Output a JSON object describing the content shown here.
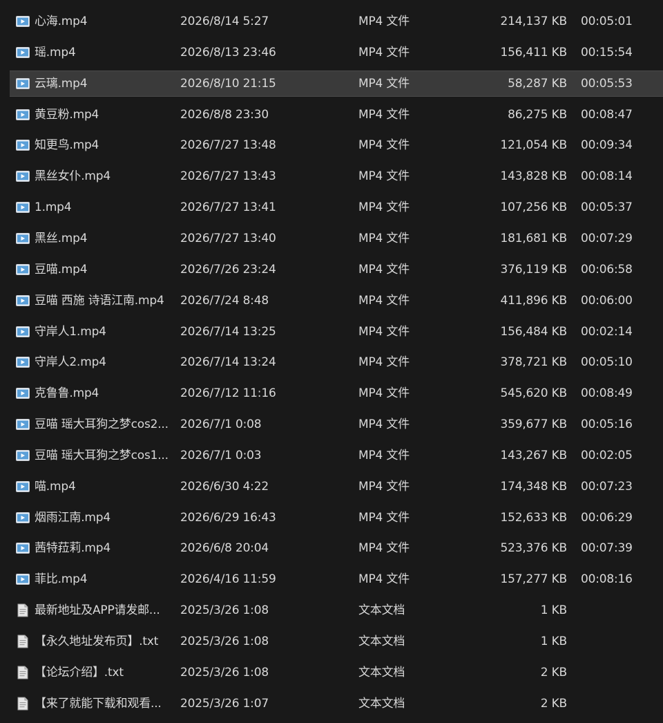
{
  "files": [
    {
      "name": "心海.mp4",
      "date": "2026/8/14 5:27",
      "type": "MP4 文件",
      "size": "214,137 KB",
      "duration": "00:05:01",
      "icon": "video-file-icon"
    },
    {
      "name": "瑶.mp4",
      "date": "2026/8/13 23:46",
      "type": "MP4 文件",
      "size": "156,411 KB",
      "duration": "00:15:54",
      "icon": "video-file-icon"
    },
    {
      "name": "云璃.mp4",
      "date": "2026/8/10 21:15",
      "type": "MP4 文件",
      "size": "58,287 KB",
      "duration": "00:05:53",
      "icon": "video-file-icon",
      "selected": true
    },
    {
      "name": "黄豆粉.mp4",
      "date": "2026/8/8 23:30",
      "type": "MP4 文件",
      "size": "86,275 KB",
      "duration": "00:08:47",
      "icon": "video-file-icon"
    },
    {
      "name": "知更鸟.mp4",
      "date": "2026/7/27 13:48",
      "type": "MP4 文件",
      "size": "121,054 KB",
      "duration": "00:09:34",
      "icon": "video-file-icon"
    },
    {
      "name": "黑丝女仆.mp4",
      "date": "2026/7/27 13:43",
      "type": "MP4 文件",
      "size": "143,828 KB",
      "duration": "00:08:14",
      "icon": "video-file-icon"
    },
    {
      "name": "1.mp4",
      "date": "2026/7/27 13:41",
      "type": "MP4 文件",
      "size": "107,256 KB",
      "duration": "00:05:37",
      "icon": "video-file-icon"
    },
    {
      "name": "黑丝.mp4",
      "date": "2026/7/27 13:40",
      "type": "MP4 文件",
      "size": "181,681 KB",
      "duration": "00:07:29",
      "icon": "video-file-icon"
    },
    {
      "name": "豆喵.mp4",
      "date": "2026/7/26 23:24",
      "type": "MP4 文件",
      "size": "376,119 KB",
      "duration": "00:06:58",
      "icon": "video-file-icon"
    },
    {
      "name": "豆喵 西施 诗语江南.mp4",
      "date": "2026/7/24 8:48",
      "type": "MP4 文件",
      "size": "411,896 KB",
      "duration": "00:06:00",
      "icon": "video-file-icon"
    },
    {
      "name": "守岸人1.mp4",
      "date": "2026/7/14 13:25",
      "type": "MP4 文件",
      "size": "156,484 KB",
      "duration": "00:02:14",
      "icon": "video-file-icon"
    },
    {
      "name": "守岸人2.mp4",
      "date": "2026/7/14 13:24",
      "type": "MP4 文件",
      "size": "378,721 KB",
      "duration": "00:05:10",
      "icon": "video-file-icon"
    },
    {
      "name": "克鲁鲁.mp4",
      "date": "2026/7/12 11:16",
      "type": "MP4 文件",
      "size": "545,620 KB",
      "duration": "00:08:49",
      "icon": "video-file-icon"
    },
    {
      "name": "豆喵 瑶大耳狗之梦cos2...",
      "date": "2026/7/1 0:08",
      "type": "MP4 文件",
      "size": "359,677 KB",
      "duration": "00:05:16",
      "icon": "video-file-icon"
    },
    {
      "name": "豆喵 瑶大耳狗之梦cos1...",
      "date": "2026/7/1 0:03",
      "type": "MP4 文件",
      "size": "143,267 KB",
      "duration": "00:02:05",
      "icon": "video-file-icon"
    },
    {
      "name": "喵.mp4",
      "date": "2026/6/30 4:22",
      "type": "MP4 文件",
      "size": "174,348 KB",
      "duration": "00:07:23",
      "icon": "video-file-icon"
    },
    {
      "name": "烟雨江南.mp4",
      "date": "2026/6/29 16:43",
      "type": "MP4 文件",
      "size": "152,633 KB",
      "duration": "00:06:29",
      "icon": "video-file-icon"
    },
    {
      "name": "茜特菈莉.mp4",
      "date": "2026/6/8 20:04",
      "type": "MP4 文件",
      "size": "523,376 KB",
      "duration": "00:07:39",
      "icon": "video-file-icon"
    },
    {
      "name": "菲比.mp4",
      "date": "2026/4/16 11:59",
      "type": "MP4 文件",
      "size": "157,277 KB",
      "duration": "00:08:16",
      "icon": "video-file-icon"
    },
    {
      "name": "最新地址及APP请发邮...",
      "date": "2025/3/26 1:08",
      "type": "文本文档",
      "size": "1 KB",
      "duration": "",
      "icon": "text-file-icon"
    },
    {
      "name": "【永久地址发布页】.txt",
      "date": "2025/3/26 1:08",
      "type": "文本文档",
      "size": "1 KB",
      "duration": "",
      "icon": "text-file-icon"
    },
    {
      "name": "【论坛介绍】.txt",
      "date": "2025/3/26 1:08",
      "type": "文本文档",
      "size": "2 KB",
      "duration": "",
      "icon": "text-file-icon"
    },
    {
      "name": "【来了就能下载和观看...",
      "date": "2025/3/26 1:07",
      "type": "文本文档",
      "size": "2 KB",
      "duration": "",
      "icon": "text-file-icon"
    }
  ],
  "colors": {
    "background": "#191919",
    "selected_row": "#3a3a3a",
    "text": "#d8d8d8",
    "video_icon": "#5a9fd8",
    "text_icon": "#e6e6e6"
  }
}
